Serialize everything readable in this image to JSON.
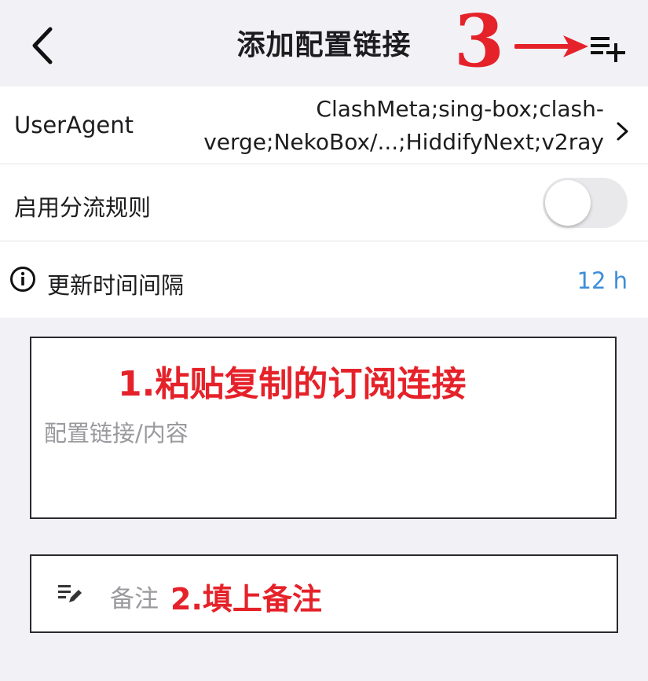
{
  "header": {
    "title": "添加配置链接",
    "back_icon": "chevron-left-icon",
    "add_list_icon": "playlist-add-icon"
  },
  "user_agent": {
    "label": "UserAgent",
    "value_line1": "ClashMeta;sing-box;clash-",
    "value_line2": "verge;NekoBox/...;HiddifyNext;v2ray"
  },
  "routing_rules": {
    "label": "启用分流规则",
    "enabled": false
  },
  "update_interval": {
    "label": "更新时间间隔",
    "value": "12 h",
    "icon": "info-icon"
  },
  "link_input": {
    "placeholder": "配置链接/内容",
    "value": ""
  },
  "note_input": {
    "placeholder": "备注",
    "value": "",
    "icon": "edit-note-icon"
  },
  "annotations": {
    "step1": "1.粘贴复制的订阅连接",
    "step2": "2.填上备注",
    "step3": "3"
  },
  "colors": {
    "annotation": "#e5222a",
    "accent_value": "#3d8ed9",
    "background": "#f2f2f6"
  }
}
